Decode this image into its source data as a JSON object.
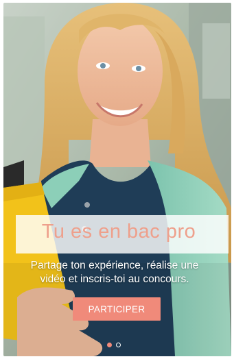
{
  "hero": {
    "image_alt": "smiling-student-photo"
  },
  "banner": {
    "title": "Tu es en bac pro"
  },
  "subtitle": "Partage ton expérience, réalise une\nvidéo et inscris-toi au concours.",
  "cta": {
    "label": "PARTICIPER"
  },
  "pager": {
    "count": 2,
    "active_index": 0
  },
  "colors": {
    "accent": "#f08a7a",
    "title": "#eea08c",
    "cardigan": "#9bd6c0",
    "shirt": "#1f3d57",
    "folder": "#f2c21a"
  }
}
